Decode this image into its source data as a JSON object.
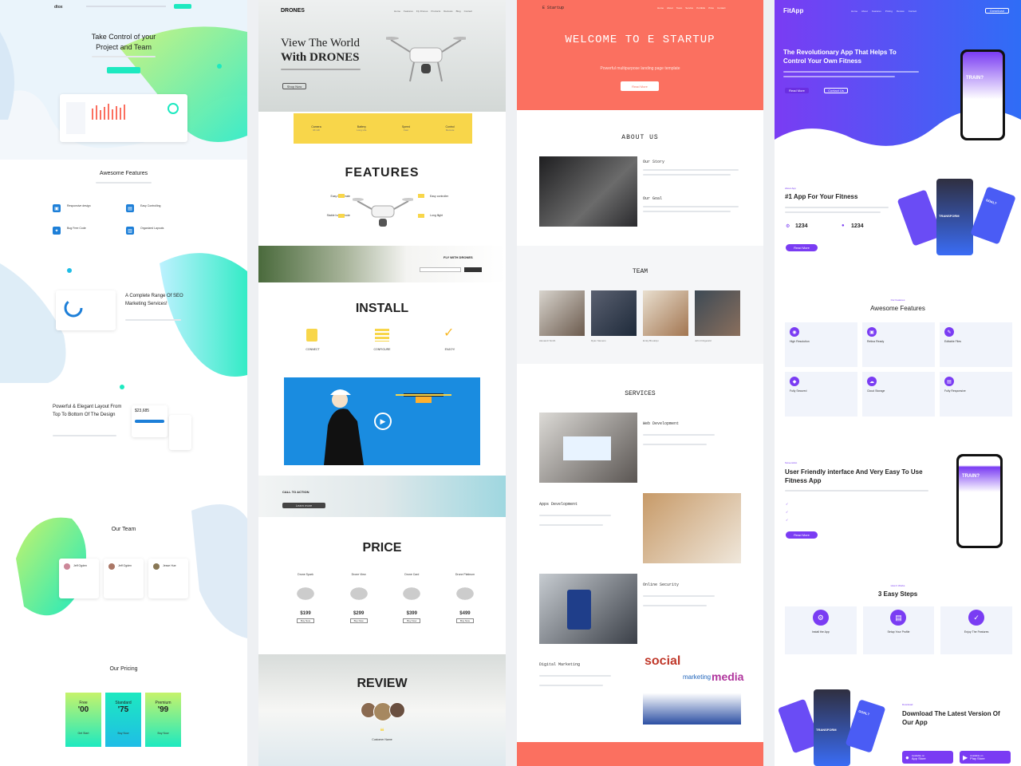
{
  "colors": {
    "teal": "#1de9c0",
    "lime": "#c6f36b",
    "purple": "#7a3cf3",
    "coral": "#fb7060",
    "yellow": "#f8d64a",
    "blue": "#1d7fd8"
  },
  "dtox": {
    "brand": "dtox",
    "hero_title": "Take Control of your Project and Team",
    "features_title": "Awesome Features",
    "features": [
      "Responsive design",
      "Easy Controlling",
      "Bug Free Code",
      "Organized Layouts"
    ],
    "seo_title": "A Complete Range Of SEO Marketing Services!",
    "layout_title": "Powerful & Elegant Layout From Top To Bottom Of The Design",
    "stat": "$23,685",
    "team_title": "Our Team",
    "team": [
      "Jeff Ogden",
      "Jeff Ogden",
      "Jesse Hue"
    ],
    "pricing_title": "Our Pricing",
    "plans": [
      {
        "name": "Free",
        "price": "'00",
        "cta": "Get Start"
      },
      {
        "name": "Standard",
        "price": "'75",
        "cta": "Buy Now"
      },
      {
        "name": "Premium",
        "price": "'99",
        "cta": "Buy Now"
      }
    ]
  },
  "drones": {
    "brand": "DRONES",
    "nav": [
      "Home",
      "Features",
      "Fly Drones",
      "Products",
      "Reviews",
      "Blog",
      "Contact"
    ],
    "hero_line1": "View The World",
    "hero_line2": "With DRONES",
    "hero_btn": "Shop Now",
    "specs": [
      {
        "label": "Camera",
        "sub": "4K HD"
      },
      {
        "label": "Battery",
        "sub": "Long Life"
      },
      {
        "label": "Speed",
        "sub": "Fast"
      },
      {
        "label": "Control",
        "sub": "Remote"
      }
    ],
    "features_title": "FEATURES",
    "feature_left": [
      "Easy to operate",
      "Stable hover mode"
    ],
    "feature_right": [
      "Easy controller",
      "Long flight"
    ],
    "fly_title": "FLY WITH DRONES",
    "install_title": "INSTALL",
    "steps": [
      "CONNECT",
      "CONFIGURE",
      "ENJOY!"
    ],
    "cta_title": "CALL TO ACTION",
    "cta_btn": "Learn more",
    "price_title": "PRICE",
    "products": [
      {
        "name": "Drone Spark",
        "price": "$199"
      },
      {
        "name": "Drone View",
        "price": "$299"
      },
      {
        "name": "Drone Card",
        "price": "$399"
      },
      {
        "name": "Drone Platinum",
        "price": "$499"
      }
    ],
    "buy_label": "Buy Now",
    "review_title": "REVIEW",
    "reviewer": "Customer Name"
  },
  "startup": {
    "brand": "E Startup",
    "nav": [
      "Home",
      "About",
      "Team",
      "Service",
      "Portfolio",
      "Price",
      "Contact"
    ],
    "welcome": "WELCOME TO E STARTUP",
    "tagline": "Powerful multipurpose landing page template",
    "hero_btn": "Read More",
    "about_title": "ABOUT US",
    "story_title": "Our Story",
    "goal_title": "Our Goal",
    "team_title": "TEAM",
    "team": [
      "Alexandr Smith",
      "Ryan Stevens",
      "Emily Brooklyn",
      "John Fitzgerald"
    ],
    "services_title": "SERVICES",
    "services": [
      "Web Development",
      "Apps Development",
      "Online Security",
      "Digital Marketing"
    ],
    "social_word": "social",
    "marketing_word": "marketing",
    "media_word": "media"
  },
  "fitapp": {
    "brand": "FitApp",
    "nav": [
      "Home",
      "About",
      "Features",
      "Pricing",
      "Review",
      "Contact"
    ],
    "nav_btn": "Download",
    "hero_title": "The Revolutionary App That Helps To Control Your Own Fitness",
    "btn1": "Read More",
    "btn2": "Contact Us",
    "phone_word": "TRAIN?",
    "about_kicker": "About App",
    "about_title": "#1 App For Your Fitness",
    "stat1": "1234",
    "stat2": "1234",
    "about_btn": "Read More",
    "transform_word": "TRANSFORM",
    "goal_word": "GOAL?",
    "features_kicker": "Our Features",
    "features_title": "Awesome Features",
    "features": [
      "High Resolution",
      "Retina Ready",
      "Editable Files",
      "Fully Secured",
      "Cloud Storage",
      "Fully Responsive"
    ],
    "ui_kicker": "Screenshot",
    "ui_title": "User Friendly interface And Very Easy To Use Fitness App",
    "ui_btn": "Read More",
    "steps_kicker": "How It Works",
    "steps_title": "3 Easy Steps",
    "steps": [
      "Install the App",
      "Setup Your Profile",
      "Enjoy The Features"
    ],
    "download_kicker": "Download",
    "download_title": "Download The Latest Version Of Our App",
    "store1_small": "Available on",
    "store1": "App Store",
    "store2_small": "Available on",
    "store2": "Play Store"
  }
}
